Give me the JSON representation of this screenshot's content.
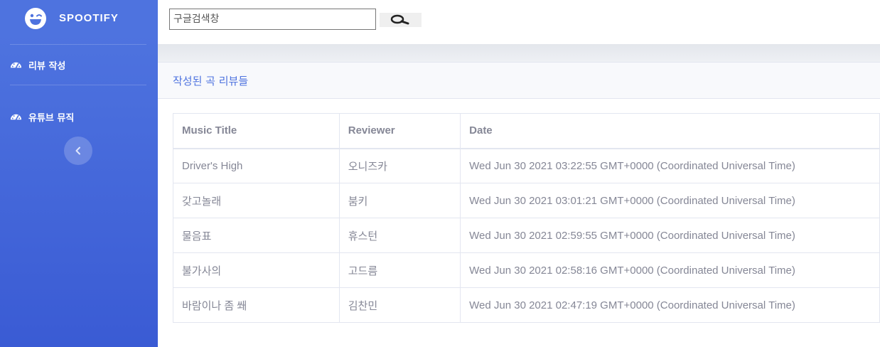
{
  "sidebar": {
    "brand": "SPOOTIFY",
    "items": [
      {
        "label": "리뷰 작성",
        "icon": "tachometer-icon"
      },
      {
        "label": "유튜브 뮤직",
        "icon": "tachometer-icon"
      }
    ],
    "toggle_icon": "chevron-left-icon"
  },
  "topbar": {
    "search_placeholder": "구글검색창",
    "search_button_icon": "magnifier-icon"
  },
  "card": {
    "title": "작성된 곡 리뷰들"
  },
  "table": {
    "headers": [
      "Music Title",
      "Reviewer",
      "Date"
    ],
    "rows": [
      {
        "title": "Driver's High",
        "reviewer": "오니즈카",
        "date": "Wed Jun 30 2021 03:22:55 GMT+0000 (Coordinated Universal Time)"
      },
      {
        "title": "갖고놀래",
        "reviewer": "붐키",
        "date": "Wed Jun 30 2021 03:01:21 GMT+0000 (Coordinated Universal Time)"
      },
      {
        "title": "물음표",
        "reviewer": "휴스턴",
        "date": "Wed Jun 30 2021 02:59:55 GMT+0000 (Coordinated Universal Time)"
      },
      {
        "title": "불가사의",
        "reviewer": "고드름",
        "date": "Wed Jun 30 2021 02:58:16 GMT+0000 (Coordinated Universal Time)"
      },
      {
        "title": "바람이나 좀 쐐",
        "reviewer": "김찬민",
        "date": "Wed Jun 30 2021 02:47:19 GMT+0000 (Coordinated Universal Time)"
      }
    ]
  },
  "colors": {
    "sidebar_gradient_top": "#4e73df",
    "sidebar_gradient_bottom": "#3a5bd4",
    "accent": "#4e73df",
    "muted_text": "#858796"
  }
}
